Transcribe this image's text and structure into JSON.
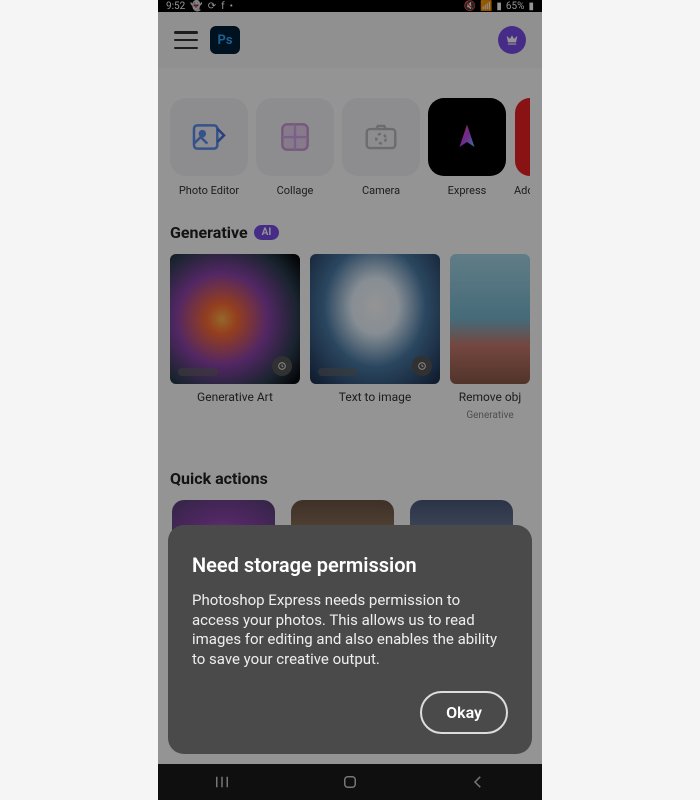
{
  "status": {
    "time": "9:52",
    "battery": "65%"
  },
  "header": {
    "logo_text": "Ps"
  },
  "tools": [
    {
      "label": "Photo Editor"
    },
    {
      "label": "Collage"
    },
    {
      "label": "Camera"
    },
    {
      "label": "Express"
    },
    {
      "label": "Adobe"
    }
  ],
  "generative": {
    "title": "Generative",
    "badge": "AI",
    "items": [
      {
        "label": "Generative Art",
        "sublabel": ""
      },
      {
        "label": "Text to image",
        "sublabel": ""
      },
      {
        "label": "Remove obj",
        "sublabel": "Generative"
      }
    ]
  },
  "quick": {
    "title": "Quick actions"
  },
  "dialog": {
    "title": "Need storage permission",
    "body": "Photoshop Express needs permission to access your photos. This allows us to read images for editing and also enables the ability to save your creative output.",
    "okay": "Okay"
  }
}
